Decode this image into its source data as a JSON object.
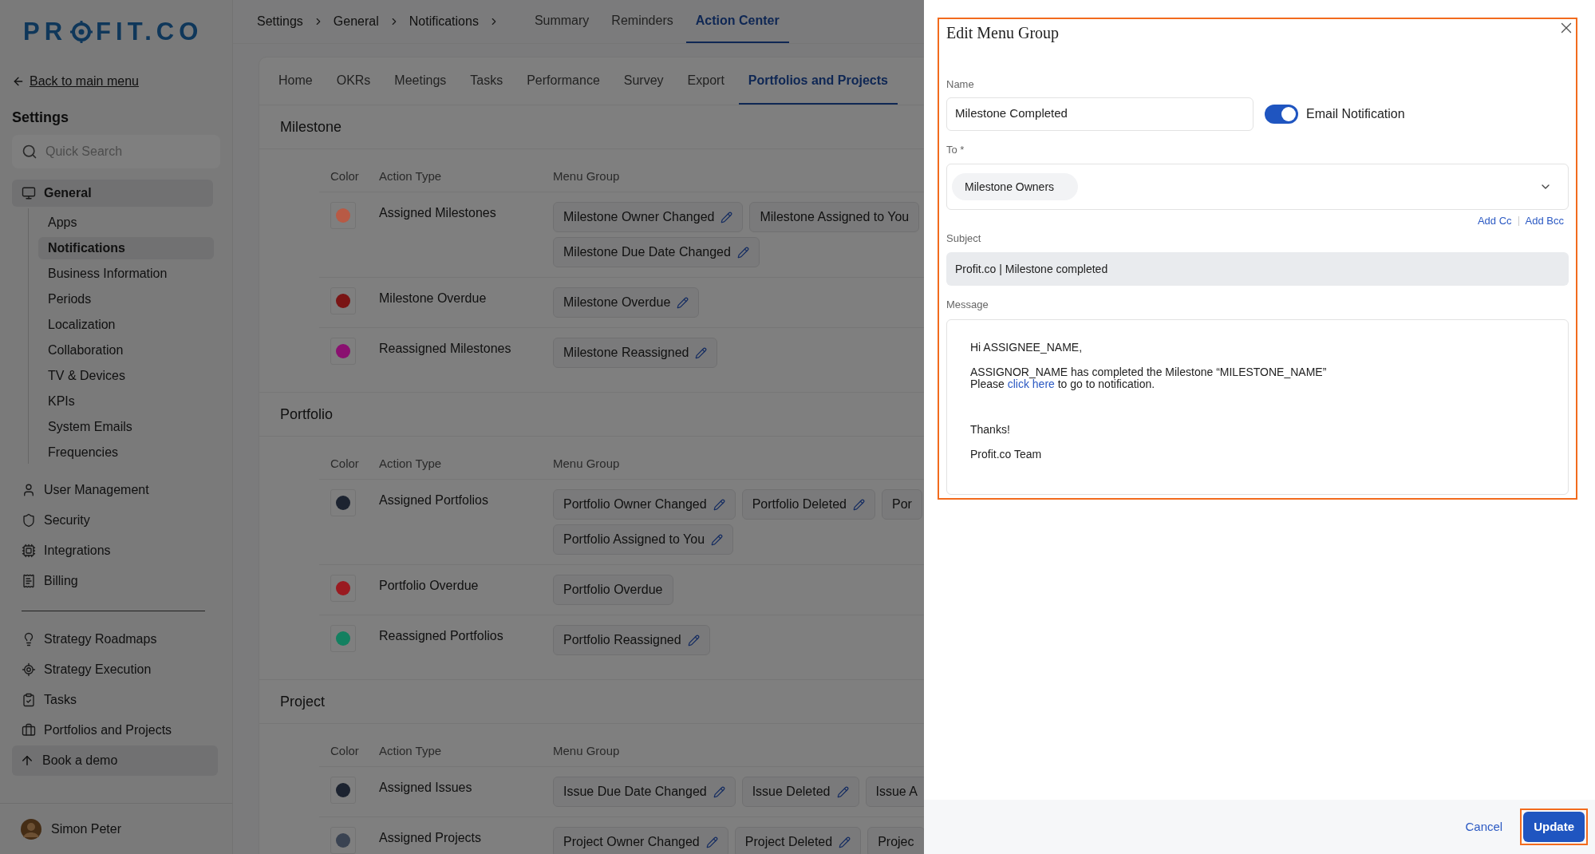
{
  "sidebar": {
    "logo": {
      "before": "PR",
      "after": "FIT.CO"
    },
    "back_link": "Back to main menu",
    "title": "Settings",
    "search": {
      "placeholder": "Quick Search"
    },
    "items": [
      {
        "label": "General",
        "selected": true,
        "children": [
          {
            "label": "Apps",
            "selected": false
          },
          {
            "label": "Notifications",
            "selected": true
          },
          {
            "label": "Business Information",
            "selected": false
          },
          {
            "label": "Periods",
            "selected": false
          },
          {
            "label": "Localization",
            "selected": false
          },
          {
            "label": "Collaboration",
            "selected": false
          },
          {
            "label": "TV & Devices",
            "selected": false
          },
          {
            "label": "KPIs",
            "selected": false
          },
          {
            "label": "System Emails",
            "selected": false
          },
          {
            "label": "Frequencies",
            "selected": false
          }
        ]
      },
      {
        "label": "User Management",
        "selected": false
      },
      {
        "label": "Security",
        "selected": false
      },
      {
        "label": "Integrations",
        "selected": false
      },
      {
        "label": "Billing",
        "selected": false
      }
    ],
    "apps": [
      {
        "label": "Strategy Roadmaps"
      },
      {
        "label": "Strategy Execution"
      },
      {
        "label": "Tasks"
      },
      {
        "label": "Portfolios and Projects"
      }
    ],
    "demo_button": "Book a demo",
    "user": {
      "name": "Simon Peter"
    }
  },
  "breadcrumbs": [
    "Settings",
    "General",
    "Notifications"
  ],
  "top_tabs": [
    {
      "label": "Summary",
      "selected": false
    },
    {
      "label": "Reminders",
      "selected": false
    },
    {
      "label": "Action Center",
      "selected": true
    }
  ],
  "module_tabs": [
    {
      "label": "Home",
      "selected": false
    },
    {
      "label": "OKRs",
      "selected": false
    },
    {
      "label": "Meetings",
      "selected": false
    },
    {
      "label": "Tasks",
      "selected": false
    },
    {
      "label": "Performance",
      "selected": false
    },
    {
      "label": "Survey",
      "selected": false
    },
    {
      "label": "Export",
      "selected": false
    },
    {
      "label": "Portfolios and Projects",
      "selected": true
    }
  ],
  "sections": [
    {
      "title": "Milestone",
      "columns": [
        "Color",
        "Action Type",
        "Menu Group"
      ],
      "rows": [
        {
          "color": "#b85a45",
          "action_type": "Assigned Milestones",
          "menu_group_lines": [
            [
              {
                "label": "Milestone Owner Changed",
                "editable": true
              },
              {
                "label": "Milestone Assigned to You",
                "editable": false
              }
            ],
            [
              {
                "label": "Milestone Due Date Changed",
                "editable": true
              }
            ]
          ]
        },
        {
          "color": "#7a1515",
          "action_type": "Milestone Overdue",
          "menu_group_lines": [
            [
              {
                "label": "Milestone Overdue",
                "editable": true
              }
            ]
          ]
        },
        {
          "color": "#8a1070",
          "action_type": "Reassigned Milestones",
          "menu_group_lines": [
            [
              {
                "label": "Milestone Reassigned",
                "editable": true
              }
            ]
          ]
        }
      ]
    },
    {
      "title": "Portfolio",
      "columns": [
        "Color",
        "Action Type",
        "Menu Group"
      ],
      "rows": [
        {
          "color": "#1c2330",
          "action_type": "Assigned Portfolios",
          "menu_group_lines": [
            [
              {
                "label": "Portfolio Owner Changed",
                "editable": true
              },
              {
                "label": "Portfolio Deleted",
                "editable": true
              },
              {
                "label": "Por",
                "editable": false
              }
            ],
            [
              {
                "label": "Portfolio Assigned to You",
                "editable": true
              }
            ]
          ]
        },
        {
          "color": "#9a1a20",
          "action_type": "Portfolio Overdue",
          "menu_group_lines": [
            [
              {
                "label": "Portfolio Overdue",
                "editable": false
              }
            ]
          ]
        },
        {
          "color": "#138060",
          "action_type": "Reassigned Portfolios",
          "menu_group_lines": [
            [
              {
                "label": "Portfolio Reassigned",
                "editable": true
              }
            ]
          ]
        }
      ]
    },
    {
      "title": "Project",
      "columns": [
        "Color",
        "Action Type",
        "Menu Group"
      ],
      "rows": [
        {
          "color": "#1c2330",
          "action_type": "Assigned Issues",
          "menu_group_lines": [
            [
              {
                "label": "Issue Due Date Changed",
                "editable": true
              },
              {
                "label": "Issue Deleted",
                "editable": true
              },
              {
                "label": "Issue A",
                "editable": false
              }
            ]
          ]
        },
        {
          "color": "#3a4352",
          "action_type": "Assigned Projects",
          "menu_group_lines": [
            [
              {
                "label": "Project Owner Changed",
                "editable": true
              },
              {
                "label": "Project Deleted",
                "editable": true
              },
              {
                "label": "Projec",
                "editable": false
              }
            ]
          ]
        }
      ]
    }
  ],
  "drawer": {
    "title": "Edit Menu Group",
    "highlighted": true,
    "name": {
      "label": "Name",
      "value": "Milestone Completed"
    },
    "email_notification": {
      "label": "Email Notification",
      "on": true
    },
    "to": {
      "label": "To *",
      "recipients": [
        "Milestone Owners"
      ]
    },
    "cc_links": [
      "Add Cc",
      "Add Bcc"
    ],
    "subject": {
      "label": "Subject",
      "value": "Profit.co | Milestone completed"
    },
    "message": {
      "label": "Message",
      "lines": [
        {
          "kind": "text",
          "text": "Hi ASSIGNEE_NAME,"
        },
        {
          "kind": "text",
          "text": "ASSIGNOR_NAME has completed the Milestone “MILESTONE_NAME”"
        },
        {
          "kind": "link",
          "before": "Please ",
          "link": "click here",
          "after": " to go to notification."
        },
        {
          "kind": "text",
          "text": "Thanks!"
        },
        {
          "kind": "text",
          "text": "Profit.co Team"
        }
      ]
    },
    "footer": {
      "cancel": "Cancel",
      "update": {
        "label": "Update",
        "highlighted": true
      }
    }
  }
}
